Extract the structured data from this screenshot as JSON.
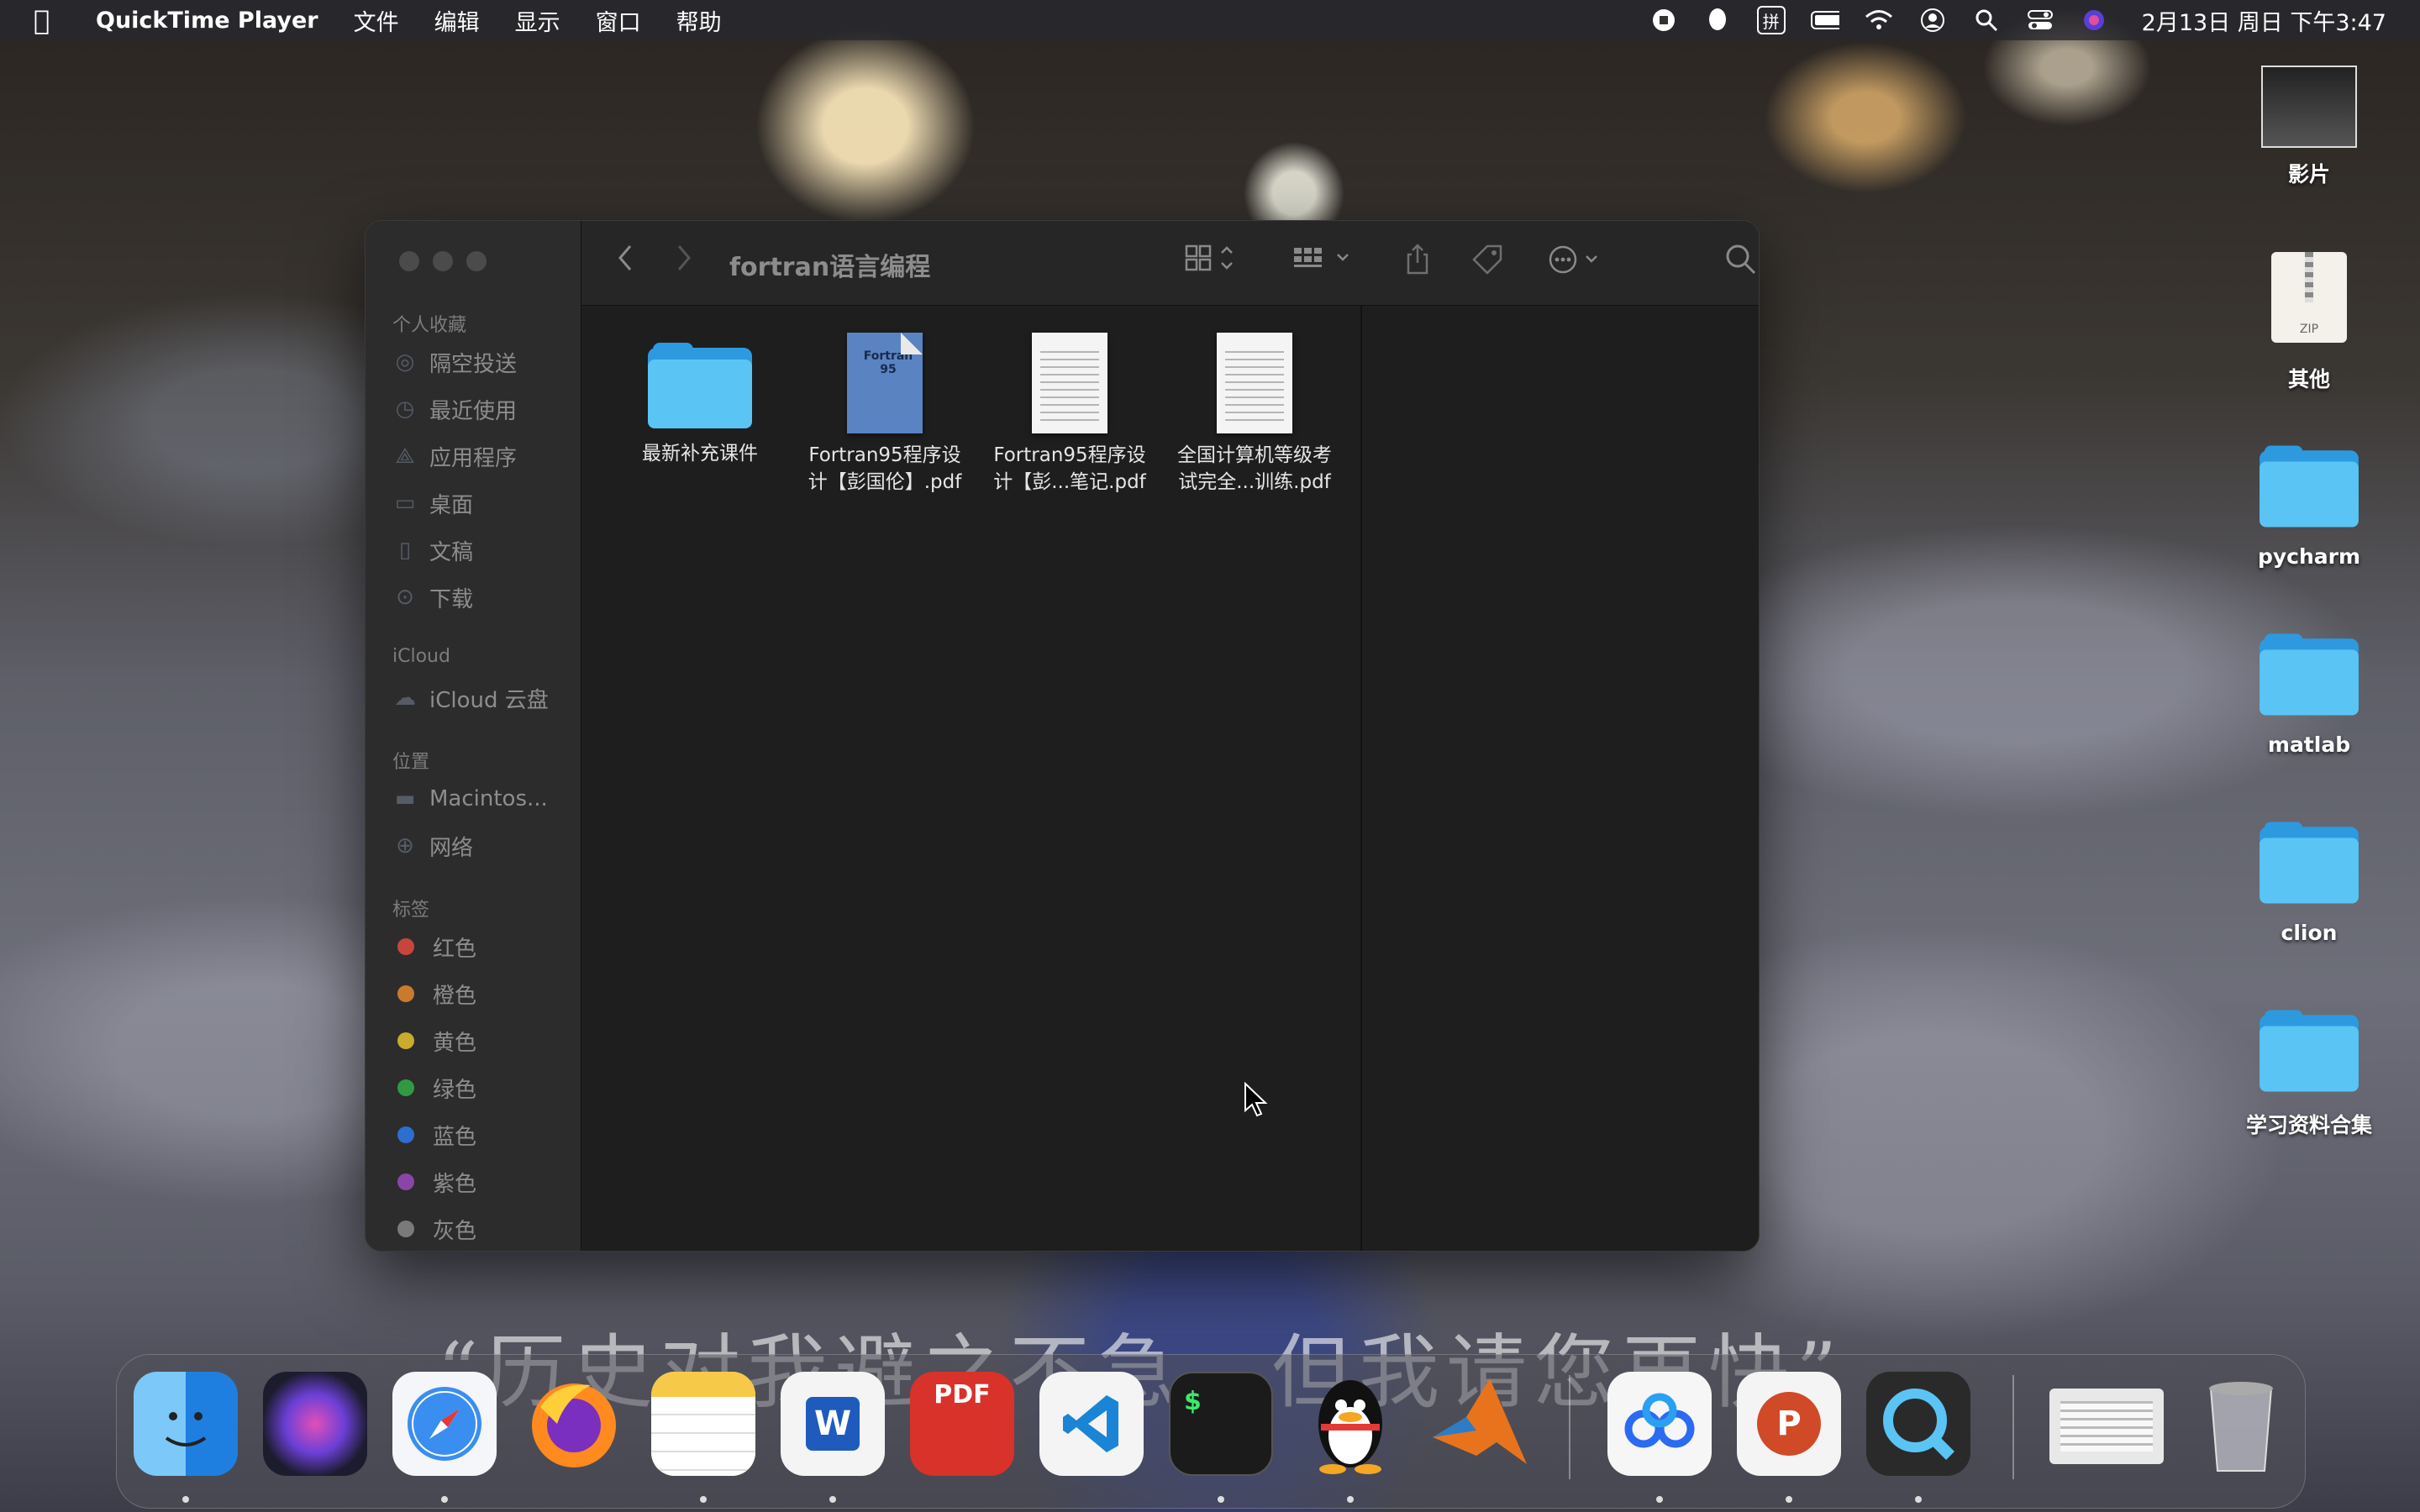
{
  "menubar": {
    "app_name": "QuickTime Player",
    "menus": [
      "文件",
      "编辑",
      "显示",
      "窗口",
      "帮助"
    ],
    "ime": "拼",
    "clock": "2月13日 周日 下午3:47"
  },
  "finder": {
    "title": "fortran语言编程",
    "sidebar": {
      "favorites_header": "个人收藏",
      "favorites": [
        "隔空投送",
        "最近使用",
        "应用程序",
        "桌面",
        "文稿",
        "下载"
      ],
      "icloud_header": "iCloud",
      "icloud": [
        "iCloud 云盘"
      ],
      "locations_header": "位置",
      "locations": [
        "Macintos...",
        "网络"
      ],
      "tags_header": "标签",
      "tags": [
        {
          "label": "红色",
          "color": "#c8453e"
        },
        {
          "label": "橙色",
          "color": "#c97b2d"
        },
        {
          "label": "黄色",
          "color": "#c9ab2d"
        },
        {
          "label": "绿色",
          "color": "#2f9a43"
        },
        {
          "label": "蓝色",
          "color": "#2c6fd1"
        },
        {
          "label": "紫色",
          "color": "#8a45a8"
        },
        {
          "label": "灰色",
          "color": "#7a7a7a"
        }
      ]
    },
    "files": [
      {
        "label_line1": "最新补充课件",
        "label_line2": "",
        "kind": "folder"
      },
      {
        "label_line1": "Fortran95程序设",
        "label_line2": "计【彭国伦】.pdf",
        "kind": "pdf-cover",
        "cover_text": "Fortran 95"
      },
      {
        "label_line1": "Fortran95程序设",
        "label_line2": "计【彭...笔记.pdf",
        "kind": "pdf"
      },
      {
        "label_line1": "全国计算机等级考",
        "label_line2": "试完全...训练.pdf",
        "kind": "pdf"
      }
    ]
  },
  "desktop": {
    "items": [
      {
        "label": "影片"
      },
      {
        "label": "其他",
        "badge": "ZIP"
      },
      {
        "label": "pycharm"
      },
      {
        "label": "matlab"
      },
      {
        "label": "clion"
      },
      {
        "label": "学习资料合集"
      }
    ]
  },
  "dock": {
    "apps": [
      "finder",
      "siri",
      "safari",
      "firefox",
      "notes",
      "word",
      "pdf-expert",
      "vscode",
      "terminal",
      "qq",
      "matlab",
      "baidu-netdisk",
      "powerpoint",
      "quicktime"
    ],
    "labels": {
      "word": "W",
      "pdf": "PDF",
      "powerpoint": "P",
      "terminal": "$"
    }
  },
  "wallpaper_text": "“历史对我避之不急，但我请您再快”"
}
